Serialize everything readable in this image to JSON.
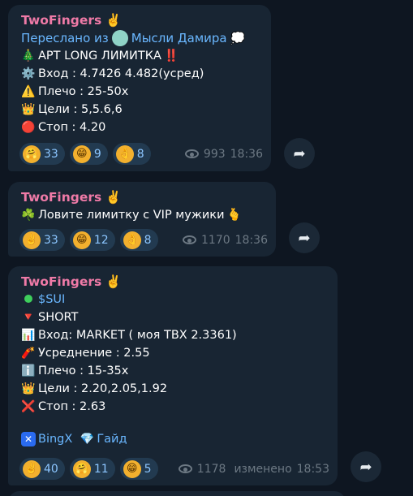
{
  "messages": [
    {
      "sender": "TwoFingers",
      "sender_emoji": "✌️",
      "forward": {
        "label": "Переслано из",
        "source": "Мысли Дамира",
        "source_emoji": "💭"
      },
      "lines": [
        {
          "emoji": "🎄",
          "text": "APT LONG ЛИМИТКА",
          "suffix": "‼️"
        },
        {
          "emoji": "⚙️",
          "text": "Вход : 4.7426 4.482(усред)"
        },
        {
          "emoji": "⚠️",
          "text": "Плечо : 25-50х"
        },
        {
          "emoji": "👑",
          "text": "Цели : 5,5.6,6"
        },
        {
          "emoji": "🔴",
          "text": "Стоп : 4.20"
        }
      ],
      "reactions": [
        {
          "emoji": "🤗",
          "count": "33"
        },
        {
          "emoji": "😁",
          "count": "9"
        },
        {
          "emoji": "👌",
          "count": "8"
        }
      ],
      "views": "993",
      "time": "18:36"
    },
    {
      "sender": "TwoFingers",
      "sender_emoji": "✌️",
      "lines": [
        {
          "emoji": "☘️",
          "text": "Ловите лимитку с VIP мужики",
          "suffix": "🫰"
        }
      ],
      "reactions": [
        {
          "emoji": "✌️",
          "count": "33"
        },
        {
          "emoji": "😁",
          "count": "12"
        },
        {
          "emoji": "👌",
          "count": "8"
        }
      ],
      "views": "1170",
      "time": "18:36"
    },
    {
      "sender": "TwoFingers",
      "sender_emoji": "✌️",
      "lines": [
        {
          "emoji": "●",
          "text": "$SUI"
        },
        {
          "emoji": "🔻",
          "text": "SHORT"
        },
        {
          "emoji": "📊",
          "text": "Вход: MARKET  ( моя ТВХ 2.3361)"
        },
        {
          "emoji": "🧨",
          "text": "Усреднение : 2.55"
        },
        {
          "emoji": "ℹ️",
          "text": "Плечо : 15-35х"
        },
        {
          "emoji": "👑",
          "text": "Цели :  2.20,2.05,1.92"
        },
        {
          "emoji": "❌",
          "text": "Стоп : 2.63"
        }
      ],
      "links": [
        {
          "icon": "✕",
          "text": "BingX"
        },
        {
          "icon": "💎",
          "text": "Гайд"
        }
      ],
      "reactions": [
        {
          "emoji": "✌️",
          "count": "40"
        },
        {
          "emoji": "🤗",
          "count": "11"
        },
        {
          "emoji": "😁",
          "count": "5"
        }
      ],
      "views": "1178",
      "edited": "изменено",
      "time": "18:53"
    }
  ],
  "share_icon": "➦",
  "colors": {
    "background": "#0e1621",
    "bubble": "#182533",
    "sender": "#ef7aa7",
    "link": "#6ab7ff",
    "meta": "#6c7883",
    "reaction_bg": "#223a50"
  }
}
